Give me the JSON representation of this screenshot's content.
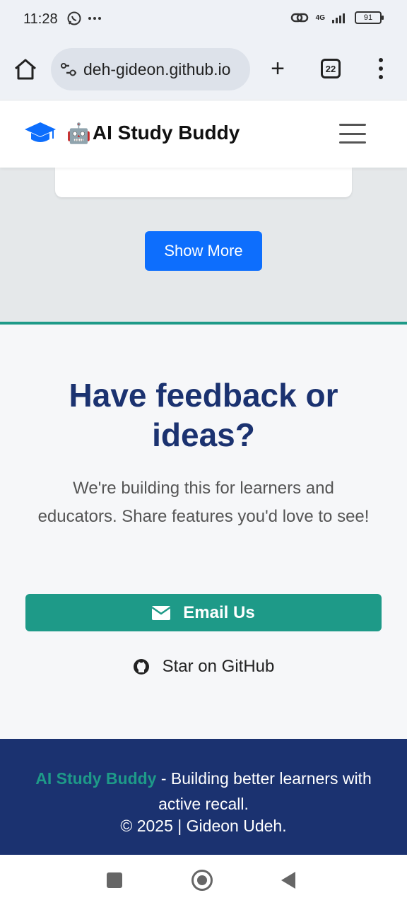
{
  "status_bar": {
    "time": "11:28",
    "network": "4G",
    "battery": "91"
  },
  "browser": {
    "url": "deh-gideon.github.io",
    "tab_count": "22"
  },
  "navbar": {
    "logo_emoji": "🤖",
    "brand": "AI Study Buddy"
  },
  "gray_section": {
    "show_more_label": "Show More"
  },
  "feedback": {
    "title": "Have feedback or ideas?",
    "text": "We're building this for learners and educators. Share features you'd love to see!",
    "email_label": "Email Us",
    "github_label": "Star on GitHub"
  },
  "footer": {
    "brand": "AI Study Buddy",
    "tagline": " - Building better learners with active recall.",
    "copyright": "© 2025 | Gideon Udeh."
  },
  "colors": {
    "primary": "#0d6efd",
    "teal": "#1e9a88",
    "navy": "#1b3270"
  },
  "icons": [
    "whatsapp-icon",
    "more-icon",
    "link-icon",
    "signal-icon",
    "battery-icon",
    "home-icon",
    "site-settings-icon",
    "plus-icon",
    "tabs-icon",
    "menu-dots-icon",
    "graduation-cap-icon",
    "hamburger-icon",
    "envelope-icon",
    "github-icon"
  ]
}
